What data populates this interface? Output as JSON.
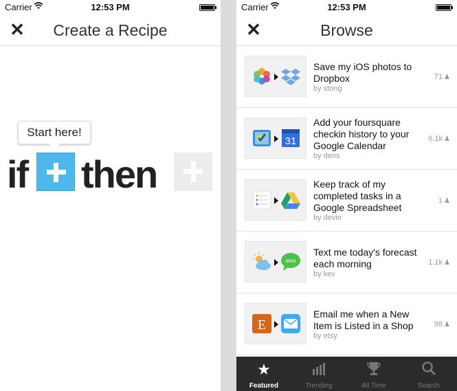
{
  "status": {
    "carrier": "Carrier",
    "time": "12:53 PM"
  },
  "left": {
    "title": "Create a Recipe",
    "tooltip": "Start here!",
    "if_word": "if",
    "then_word": "then"
  },
  "right": {
    "title": "Browse",
    "recipes": [
      {
        "title": "Save my iOS photos to Dropbox",
        "by": "by stong",
        "count": "71",
        "icons": [
          "ios-photos-icon",
          "dropbox-icon"
        ]
      },
      {
        "title": "Add your foursquare checkin history to your Google Calendar",
        "by": "by dens",
        "count": "6.1k",
        "icons": [
          "foursquare-icon",
          "google-calendar-icon"
        ]
      },
      {
        "title": "Keep track of my completed tasks in a Google Spreadsheet",
        "by": "by devin",
        "count": "1",
        "icons": [
          "reminders-icon",
          "google-drive-icon"
        ]
      },
      {
        "title": "Text me today's forecast each morning",
        "by": "by kev",
        "count": "1.1k",
        "icons": [
          "weather-icon",
          "sms-icon"
        ]
      },
      {
        "title": "Email me when a New Item is Listed in a Shop",
        "by": "by etsy",
        "count": "98",
        "icons": [
          "etsy-icon",
          "email-icon"
        ]
      }
    ],
    "tabs": [
      {
        "label": "Featured",
        "icon": "star-icon",
        "active": true
      },
      {
        "label": "Trending",
        "icon": "bars-icon",
        "active": false
      },
      {
        "label": "All Time",
        "icon": "trophy-icon",
        "active": false
      },
      {
        "label": "Search",
        "icon": "search-icon",
        "active": false
      }
    ]
  },
  "colors": {
    "accent": "#4cb8ec",
    "tabbar": "#2b2b2b"
  }
}
